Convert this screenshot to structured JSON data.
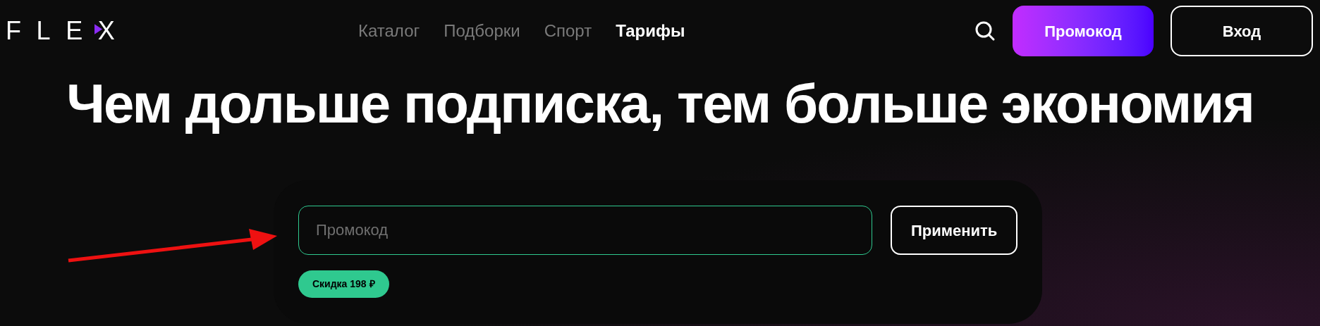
{
  "logo": "FLEX",
  "nav": [
    {
      "label": "Каталог",
      "selected": false
    },
    {
      "label": "Подборки",
      "selected": false
    },
    {
      "label": "Спорт",
      "selected": false
    },
    {
      "label": "Тарифы",
      "selected": true
    }
  ],
  "header_buttons": {
    "promo": "Промокод",
    "login": "Вход"
  },
  "title": "Чем дольше подписка, тем больше экономия",
  "promo_form": {
    "placeholder": "Промокод",
    "apply": "Применить",
    "discount": "Скидка 198 ₽"
  }
}
